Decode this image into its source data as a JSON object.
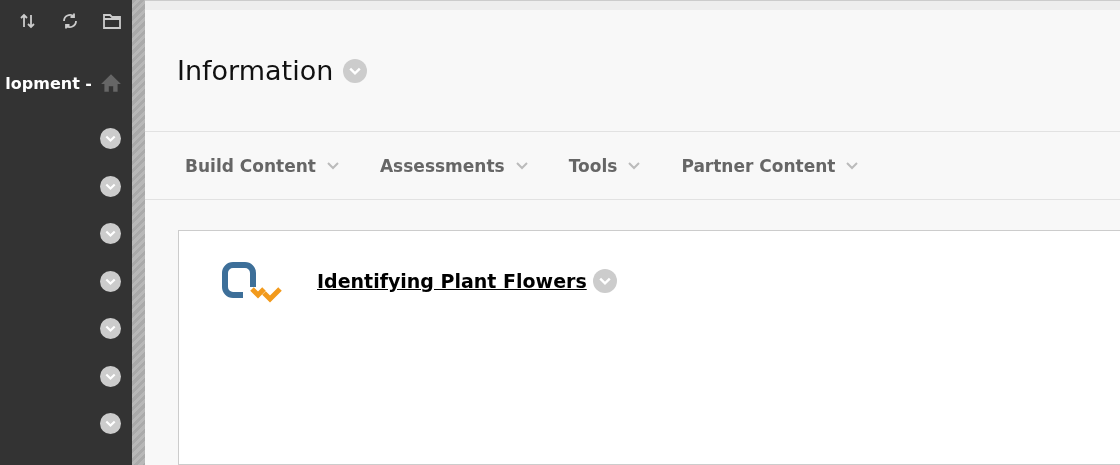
{
  "sidebar": {
    "course_title": "lopment -"
  },
  "page": {
    "title": "Information"
  },
  "action_bar": [
    {
      "label": "Build Content"
    },
    {
      "label": "Assessments"
    },
    {
      "label": "Tools"
    },
    {
      "label": "Partner Content"
    }
  ],
  "content_items": [
    {
      "title": "Identifying Plant Flowers"
    }
  ]
}
